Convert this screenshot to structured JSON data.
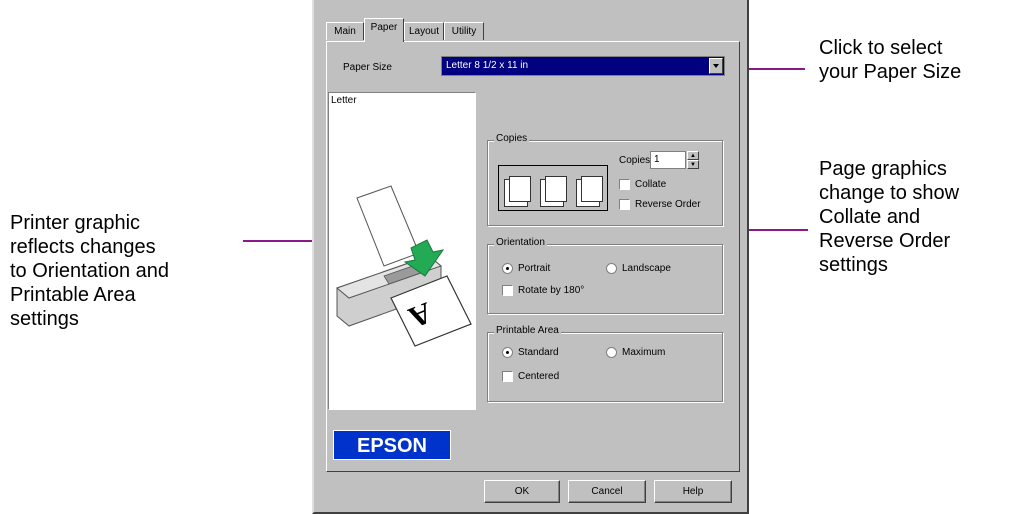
{
  "callouts": {
    "paper_size": [
      "Click to select",
      "your Paper Size"
    ],
    "page_graphics": [
      "Page graphics",
      "change to show",
      "Collate and",
      "Reverse Order",
      "settings"
    ],
    "printer_graphic": [
      "Printer graphic",
      "reflects changes",
      "to Orientation and",
      "Printable Area",
      "settings"
    ]
  },
  "tabs": [
    "Main",
    "Paper",
    "Layout",
    "Utility"
  ],
  "active_tab": "Paper",
  "paper_size": {
    "label": "Paper Size",
    "value": "Letter 8 1/2 x 11 in"
  },
  "preview": {
    "label": "Letter",
    "page_letter": "A"
  },
  "copies": {
    "group_label": "Copies",
    "count_label": "Copies",
    "count_value": "1",
    "collate_label": "Collate",
    "reverse_label": "Reverse Order"
  },
  "orientation": {
    "group_label": "Orientation",
    "portrait_label": "Portrait",
    "landscape_label": "Landscape",
    "rotate_label": "Rotate by 180°",
    "selected": "Portrait"
  },
  "printable_area": {
    "group_label": "Printable Area",
    "standard_label": "Standard",
    "maximum_label": "Maximum",
    "centered_label": "Centered",
    "selected": "Standard"
  },
  "logo": "EPSON",
  "buttons": {
    "ok": "OK",
    "cancel": "Cancel",
    "help": "Help"
  },
  "colors": {
    "selection": "#000080",
    "callout_line": "#8a1a8a",
    "logo_bg": "#0033cc",
    "arrow": "#22aa55"
  }
}
